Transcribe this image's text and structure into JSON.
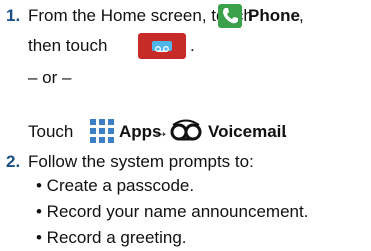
{
  "step1": {
    "number": "1.",
    "text_a": "From the Home screen, touch",
    "phone_label": "Phone",
    "comma": ",",
    "text_b": "then touch",
    "period": ".",
    "or": "– or –",
    "touch": "Touch",
    "apps_label": "Apps",
    "arrow": "→",
    "voicemail_label": "Voicemail",
    "period2": "."
  },
  "step2": {
    "number": "2.",
    "text": "Follow the system prompts to:",
    "bullets": [
      "• Create a passcode.",
      "• Record your name announcement.",
      "• Record a greeting."
    ]
  },
  "colors": {
    "number": "#1a4f86",
    "phone_icon": "#3aa04a",
    "voicemail_button": "#c62b28"
  }
}
